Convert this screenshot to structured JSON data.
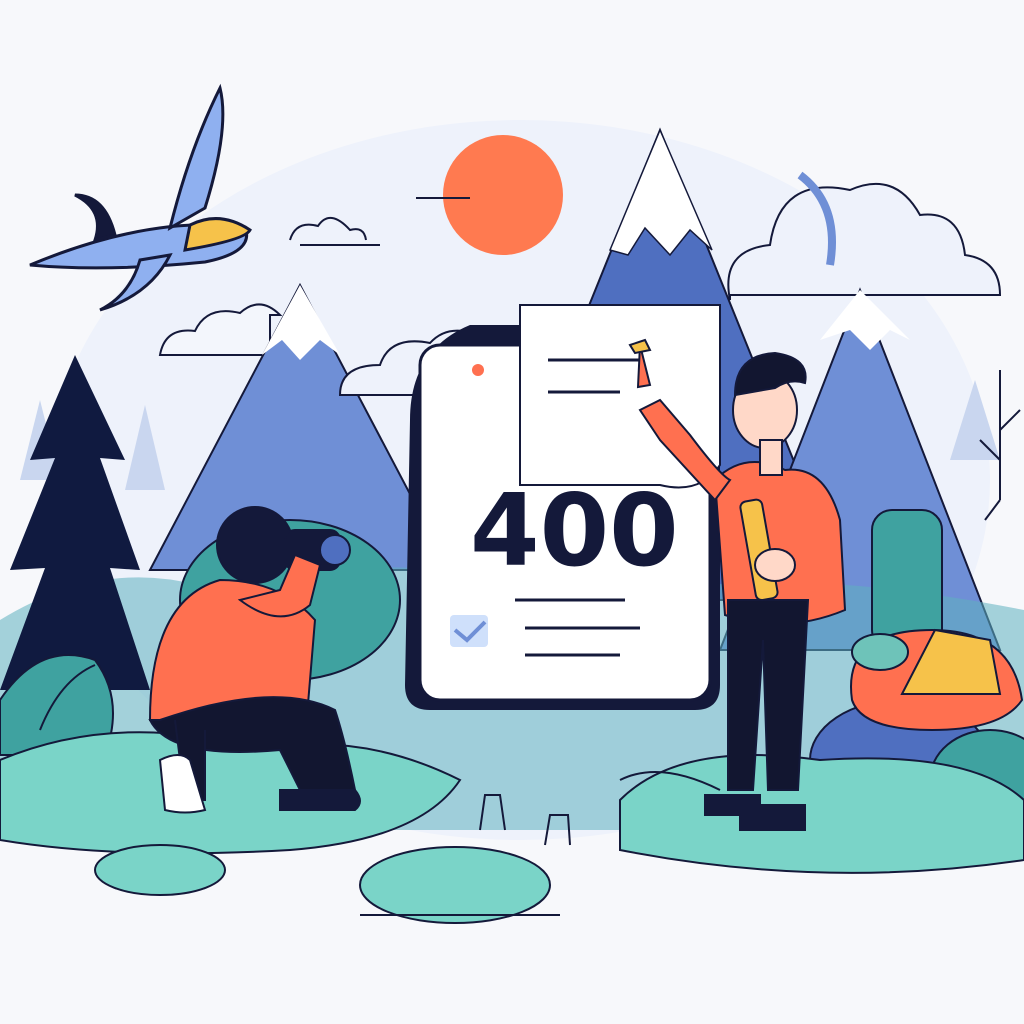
{
  "error_card": {
    "code": "400"
  },
  "colors": {
    "background": "#f7f8fb",
    "sun": "#ff7a50",
    "mountain": "#6f8fd6",
    "mountain_dark": "#4f6fc0",
    "tree_dark": "#101a40",
    "shirt": "#ff7050",
    "pants": "#121630",
    "ground": "#7ad4c8",
    "leaf": "#3fa2a0",
    "outline": "#14193a",
    "plane": "#8fb0f0",
    "plane_accent": "#f6c24a"
  },
  "icons": {
    "plane": "airplane-icon",
    "check": "checkbox-checked-icon",
    "camera": "camera-icon",
    "pencil": "pencil-icon"
  }
}
